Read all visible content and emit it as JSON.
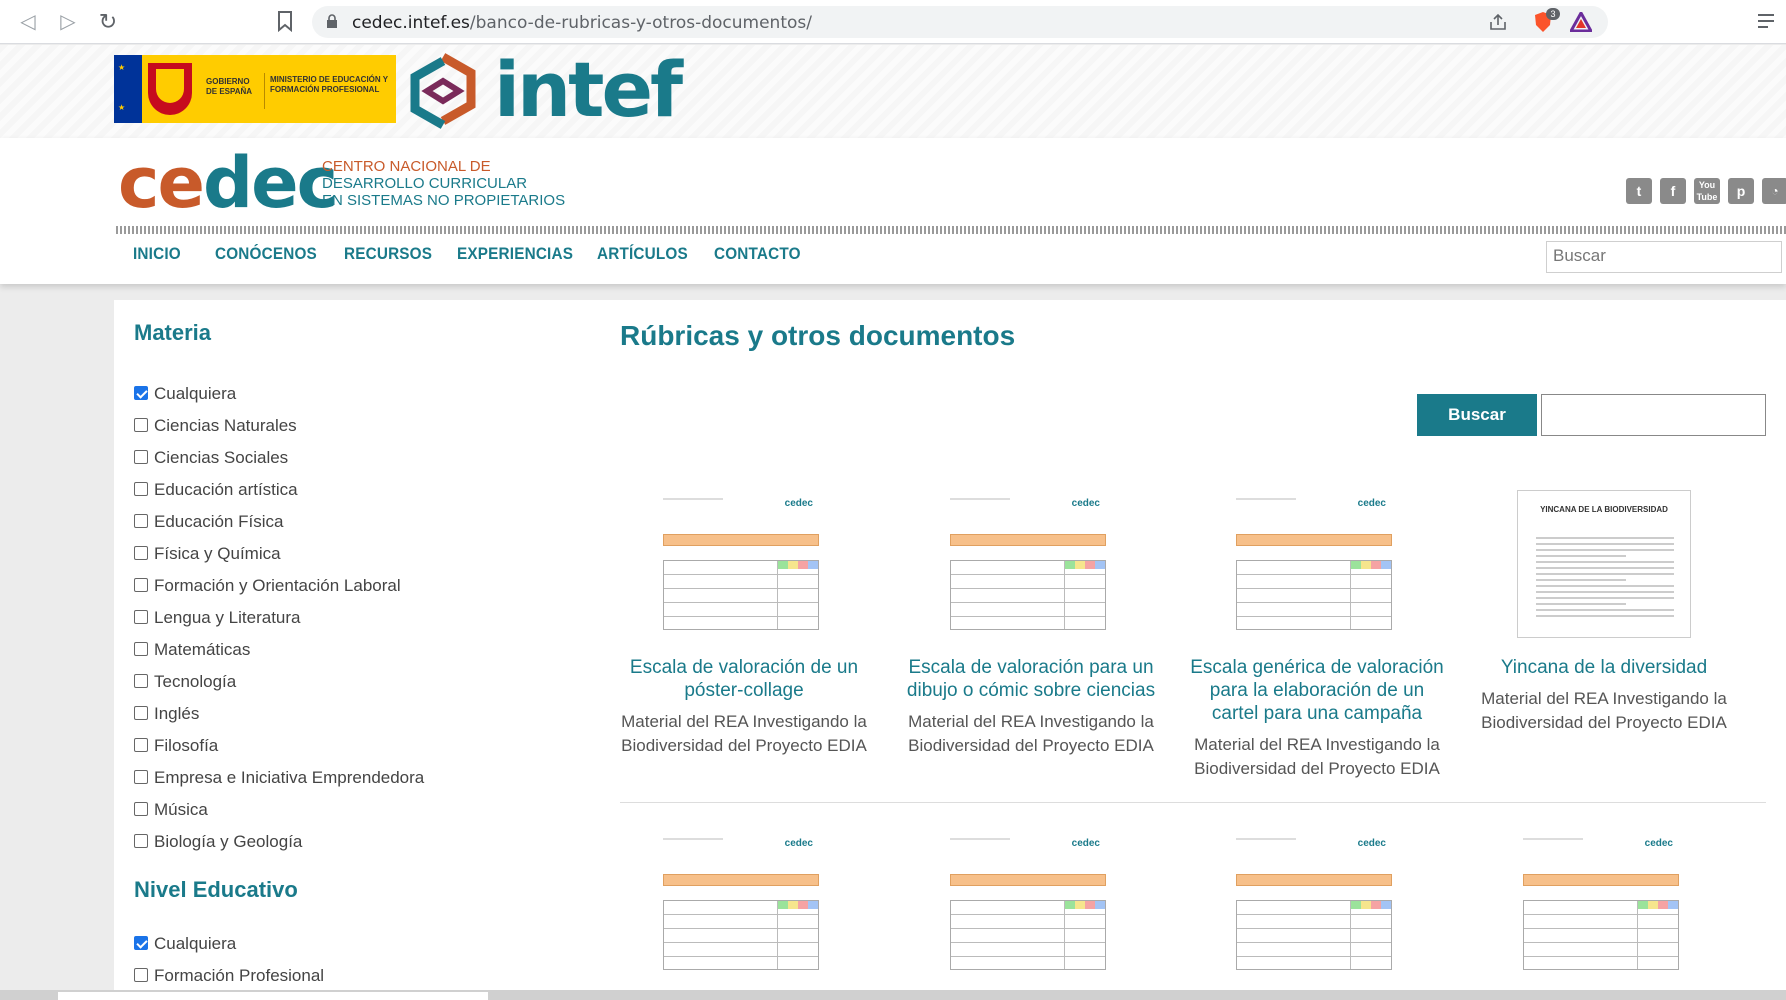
{
  "browser": {
    "url_host": "cedec.intef.es",
    "url_path": "/banco-de-rubricas-y-otros-documentos/",
    "brave_badge": "3"
  },
  "header": {
    "gov_line1": "GOBIERNO DE ESPAÑA",
    "gov_line2": "MINISTERIO DE EDUCACIÓN Y FORMACIÓN PROFESIONAL",
    "intef_logo": "intef",
    "cedec_logo_part1": "ce",
    "cedec_logo_part2": "dec",
    "cedec_sub1": "CENTRO NACIONAL DE",
    "cedec_sub2": "DESARROLLO CURRICULAR",
    "cedec_sub3": "EN SISTEMAS NO PROPIETARIOS",
    "social_icons": [
      "twitter-icon",
      "facebook-icon",
      "youtube-icon",
      "pinterest-icon",
      "rss-icon"
    ],
    "nav": [
      "INICIO",
      "CONÓCENOS",
      "RECURSOS",
      "EXPERIENCIAS",
      "ARTÍCULOS",
      "CONTACTO"
    ],
    "search_placeholder": "Buscar"
  },
  "sidebar": {
    "materia_title": "Materia",
    "materias": [
      {
        "label": "Cualquiera",
        "checked": true
      },
      {
        "label": "Ciencias Naturales",
        "checked": false
      },
      {
        "label": "Ciencias Sociales",
        "checked": false
      },
      {
        "label": "Educación artística",
        "checked": false
      },
      {
        "label": "Educación Física",
        "checked": false
      },
      {
        "label": "Física y Química",
        "checked": false
      },
      {
        "label": "Formación y Orientación Laboral",
        "checked": false
      },
      {
        "label": "Lengua y Literatura",
        "checked": false
      },
      {
        "label": "Matemáticas",
        "checked": false
      },
      {
        "label": "Tecnología",
        "checked": false
      },
      {
        "label": "Inglés",
        "checked": false
      },
      {
        "label": "Filosofía",
        "checked": false
      },
      {
        "label": "Empresa e Iniciativa Emprendedora",
        "checked": false
      },
      {
        "label": "Música",
        "checked": false
      },
      {
        "label": "Biología y Geología",
        "checked": false
      }
    ],
    "nivel_title": "Nivel Educativo",
    "niveles": [
      {
        "label": "Cualquiera",
        "checked": true
      },
      {
        "label": "Formación Profesional",
        "checked": false
      }
    ]
  },
  "main": {
    "title": "Rúbricas y otros documentos",
    "search_button": "Buscar",
    "search_value": "",
    "cards_row1": [
      {
        "title": "Escala de valoración de un póster-collage",
        "desc": "Material del REA Investigando la Biodiversidad del Proyecto EDIA",
        "thumb": "table"
      },
      {
        "title": "Escala de valoración para un dibujo o cómic sobre ciencias",
        "desc": "Material del REA Investigando la Biodiversidad del Proyecto EDIA",
        "thumb": "table"
      },
      {
        "title": "Escala genérica de valoración para la elaboración de un cartel para una campaña",
        "desc": "Material del REA Investigando la Biodiversidad del Proyecto EDIA",
        "thumb": "table"
      },
      {
        "title": "Yincana de la diversidad",
        "desc": "Material del REA Investigando la Biodiversidad del Proyecto EDIA",
        "thumb": "doc",
        "doc_heading": "YINCANA DE LA BIODIVERSIDAD"
      }
    ],
    "thumb_logo": "cedec"
  }
}
